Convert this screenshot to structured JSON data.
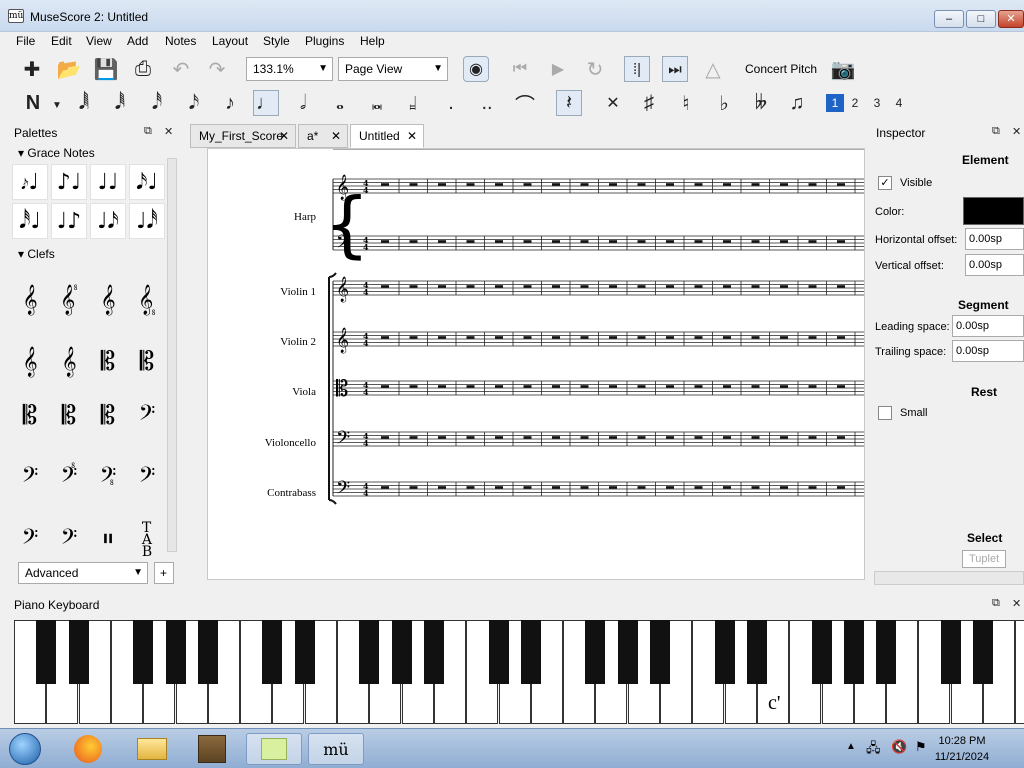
{
  "window": {
    "title": "MuseScore 2: Untitled",
    "app_icon": "mü",
    "min": "–",
    "max": "□",
    "close": "✕"
  },
  "menus": [
    "File",
    "Edit",
    "View",
    "Add",
    "Notes",
    "Layout",
    "Style",
    "Plugins",
    "Help"
  ],
  "toolbar": {
    "zoom": "133.1%",
    "view_mode": "Page View",
    "concert_pitch": "Concert Pitch"
  },
  "voices": [
    "1",
    "2",
    "3",
    "4"
  ],
  "palettes": {
    "title": "Palettes",
    "grace_notes": "Grace Notes",
    "clefs": "Clefs",
    "workspace": "Advanced",
    "add": "+"
  },
  "tabs": [
    {
      "label": "My_First_Score"
    },
    {
      "label": "a*"
    },
    {
      "label": "Untitled"
    }
  ],
  "instruments": [
    "Harp",
    "Violin 1",
    "Violin 2",
    "Viola",
    "Violoncello",
    "Contrabass"
  ],
  "inspector": {
    "title": "Inspector",
    "element": "Element",
    "visible": "Visible",
    "color_label": "Color:",
    "color_value": "#000000",
    "h_offset_label": "Horizontal offset:",
    "h_offset": "0.00sp",
    "v_offset_label": "Vertical offset:",
    "v_offset": "0.00sp",
    "segment": "Segment",
    "leading_label": "Leading space:",
    "leading": "0.00sp",
    "trailing_label": "Trailing space:",
    "trailing": "0.00sp",
    "rest": "Rest",
    "small": "Small",
    "select": "Select",
    "tuplet": "Tuplet"
  },
  "piano": {
    "title": "Piano Keyboard",
    "marker": "c'"
  },
  "taskbar": {
    "time": "10:28 PM",
    "date": "11/21/2024"
  }
}
